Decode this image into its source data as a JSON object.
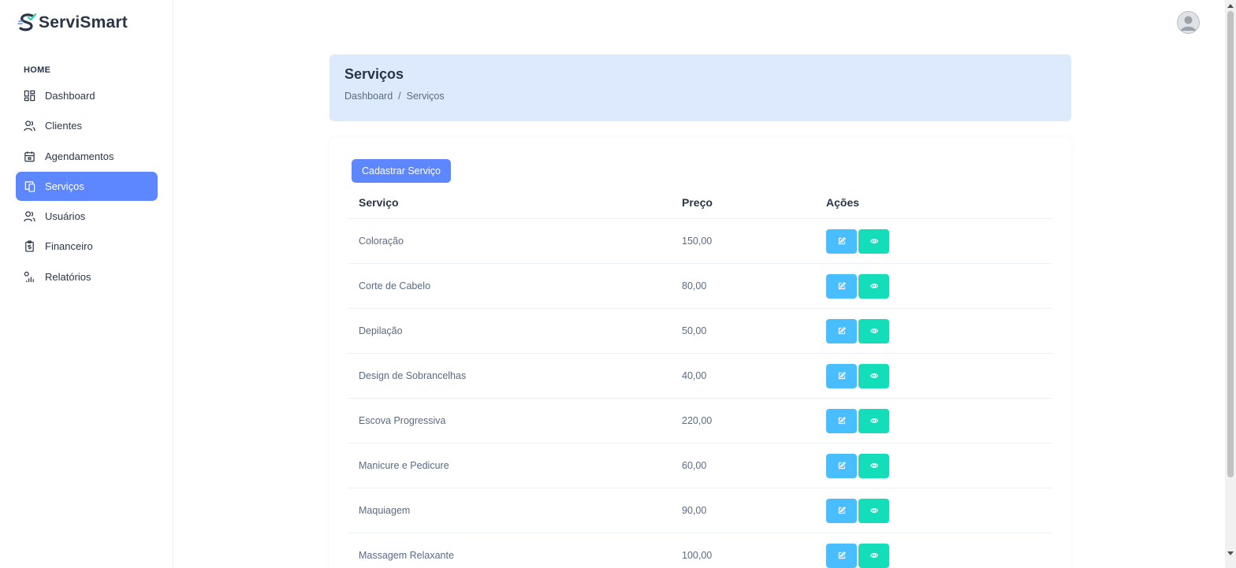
{
  "brand": {
    "name": "ServiSmart"
  },
  "sidebar": {
    "section_label": "HOME",
    "items": [
      {
        "label": "Dashboard",
        "icon": "dashboard-icon"
      },
      {
        "label": "Clientes",
        "icon": "users-icon"
      },
      {
        "label": "Agendamentos",
        "icon": "calendar-icon"
      },
      {
        "label": "Serviços",
        "icon": "devices-icon",
        "active": true
      },
      {
        "label": "Usuários",
        "icon": "users-icon"
      },
      {
        "label": "Financeiro",
        "icon": "report-money-icon"
      },
      {
        "label": "Relatórios",
        "icon": "chart-icon"
      }
    ]
  },
  "header": {
    "title": "Serviços",
    "breadcrumb": [
      "Dashboard",
      "/",
      "Serviços"
    ]
  },
  "actions": {
    "add_button": "Cadastrar Serviço"
  },
  "table": {
    "columns": [
      "Serviço",
      "Preço",
      "Ações"
    ],
    "rows": [
      {
        "servico": "Coloração",
        "preco": "150,00"
      },
      {
        "servico": "Corte de Cabelo",
        "preco": "80,00"
      },
      {
        "servico": "Depilação",
        "preco": "50,00"
      },
      {
        "servico": "Design de Sobrancelhas",
        "preco": "40,00"
      },
      {
        "servico": "Escova Progressiva",
        "preco": "220,00"
      },
      {
        "servico": "Manicure e Pedicure",
        "preco": "60,00"
      },
      {
        "servico": "Maquiagem",
        "preco": "90,00"
      },
      {
        "servico": "Massagem Relaxante",
        "preco": "100,00"
      }
    ]
  },
  "colors": {
    "primary": "#5d87ff",
    "edit": "#49beff",
    "view": "#13deb9",
    "header_bg": "#ddeafd",
    "text": "#2a3547",
    "muted": "#5a6a85"
  }
}
